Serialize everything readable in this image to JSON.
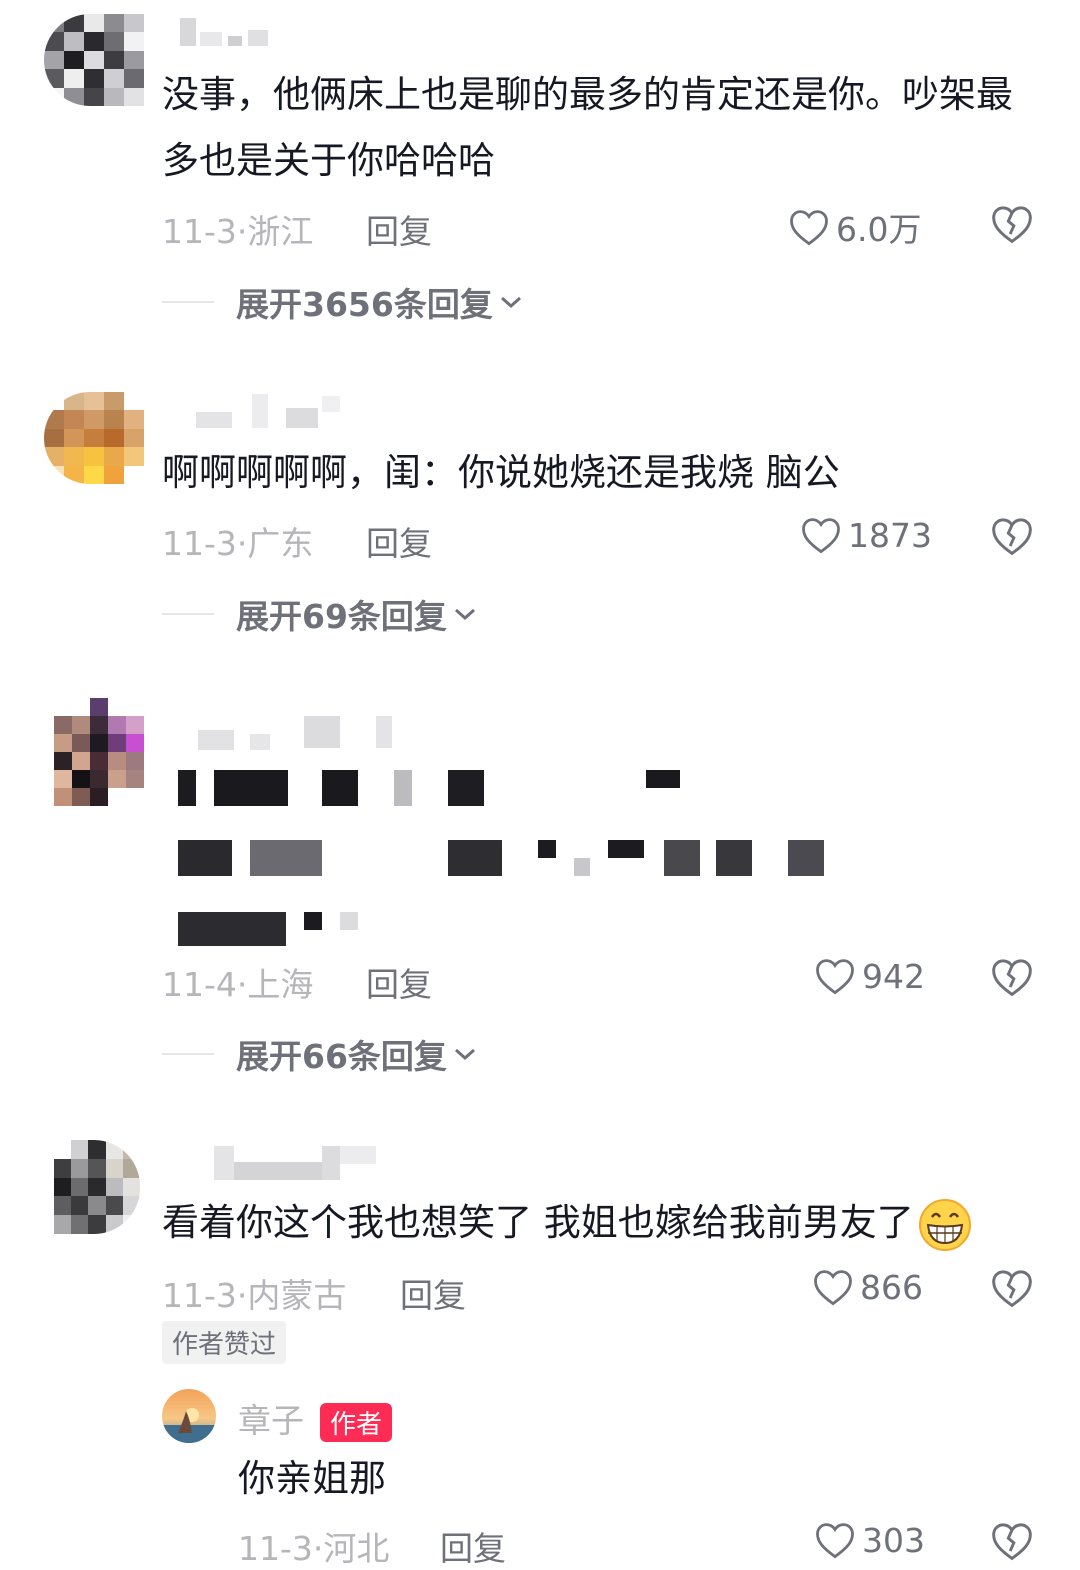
{
  "comments": [
    {
      "text": "没事，他俩床上也是聊的最多的肯定还是你。吵架最多也是关于你哈哈哈",
      "date": "11-3",
      "location": "浙江",
      "reply_label": "回复",
      "likes": "6.0万",
      "expand_label": "展开3656条回复"
    },
    {
      "text": "啊啊啊啊啊，闺：你说她烧还是我烧 脑公",
      "date": "11-3",
      "location": "广东",
      "reply_label": "回复",
      "likes": "1873",
      "expand_label": "展开69条回复"
    },
    {
      "text": "",
      "date": "11-4",
      "location": "上海",
      "reply_label": "回复",
      "likes": "942",
      "expand_label": "展开66条回复"
    },
    {
      "text": "看着你这个我也想笑了  我姐也嫁给我前男友了",
      "date": "11-3",
      "location": "内蒙古",
      "reply_label": "回复",
      "likes": "866",
      "badge": "作者赞过",
      "emoji": "grinning-emoji"
    }
  ],
  "author_reply": {
    "username": "章子",
    "tag": "作者",
    "text": "你亲姐那",
    "date": "11-3",
    "location": "河北",
    "reply_label": "回复",
    "likes": "303"
  },
  "colors": {
    "text": "#161823",
    "meta": "#b5b5ba",
    "secondary": "#6f717a",
    "author_tag": "#fe2c55"
  },
  "icons": [
    "heart-icon",
    "broken-heart-icon",
    "chevron-down-icon"
  ]
}
